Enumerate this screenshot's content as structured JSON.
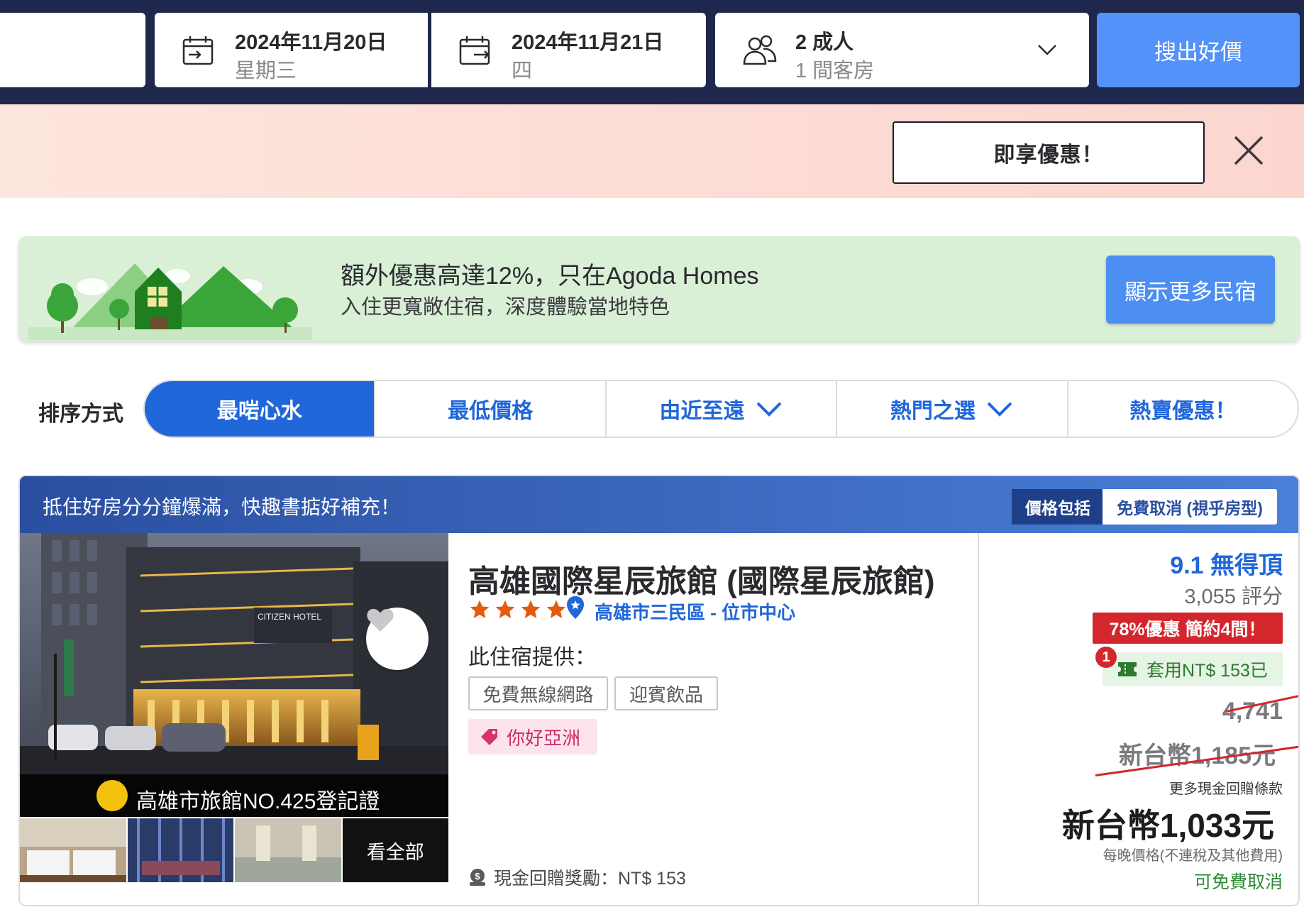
{
  "search": {
    "checkin": {
      "date": "2024年11月20日",
      "weekday": "星期三"
    },
    "checkout": {
      "date": "2024年11月21日",
      "weekday": "四"
    },
    "guests": {
      "adults": "2 成人",
      "rooms": "1 間客房"
    },
    "search_label": "搜出好價"
  },
  "promo": {
    "button_label": "即享優惠！"
  },
  "homes_banner": {
    "title": "額外優惠高達12%，只在Agoda Homes",
    "subtitle": "入住更寬敞住宿，深度體驗當地特色",
    "button_label": "顯示更多民宿"
  },
  "sort": {
    "label": "排序方式",
    "tabs": [
      {
        "label": "最啱心水",
        "active": true,
        "dropdown": false
      },
      {
        "label": "最低價格",
        "active": false,
        "dropdown": false
      },
      {
        "label": "由近至遠",
        "active": false,
        "dropdown": true
      },
      {
        "label": "熱門之選",
        "active": false,
        "dropdown": true
      },
      {
        "label": "熱賣優惠！",
        "active": false,
        "dropdown": false
      }
    ]
  },
  "hotel": {
    "header_text": "抵住好房分分鐘爆滿，快趣書掂好補充！",
    "price_includes_label": "價格包括",
    "free_cancel_tag": "免費取消 (視乎房型)",
    "license_text": "高雄市旅館NO.425登記證",
    "see_all_label": "看全部",
    "name": "高雄國際星辰旅館 (國際星辰旅館)",
    "star_rating": 4,
    "location": "高雄市三民區 - 位市中心",
    "provides_label": "此住宿提供：",
    "amenities": [
      "免費無線網路",
      "迎賓飲品"
    ],
    "program_tag": "你好亞洲",
    "cashback_text": "現金回贈獎勵：NT$ 153",
    "rating_text": "9.1 無得頂",
    "reviews_text": "3,055 評分",
    "deal_badge": "78%優惠 簡約4間！",
    "coupon_count": "1",
    "coupon_text": "套用NT$ 153已",
    "old_price_1": "4,741",
    "old_price_2": "新台幣1,185元",
    "more_cash_text": "更多現金回贈條款",
    "final_price": "新台幣1,033元",
    "per_night_text": "每晚價格(不連稅及其他費用)",
    "free_cancel_text": "可免費取消"
  },
  "colors": {
    "navy": "#20274d",
    "search_blue": "#5392f9",
    "link_blue": "#2067da",
    "deal_red": "#d3262d",
    "green": "#2f8a3a"
  }
}
